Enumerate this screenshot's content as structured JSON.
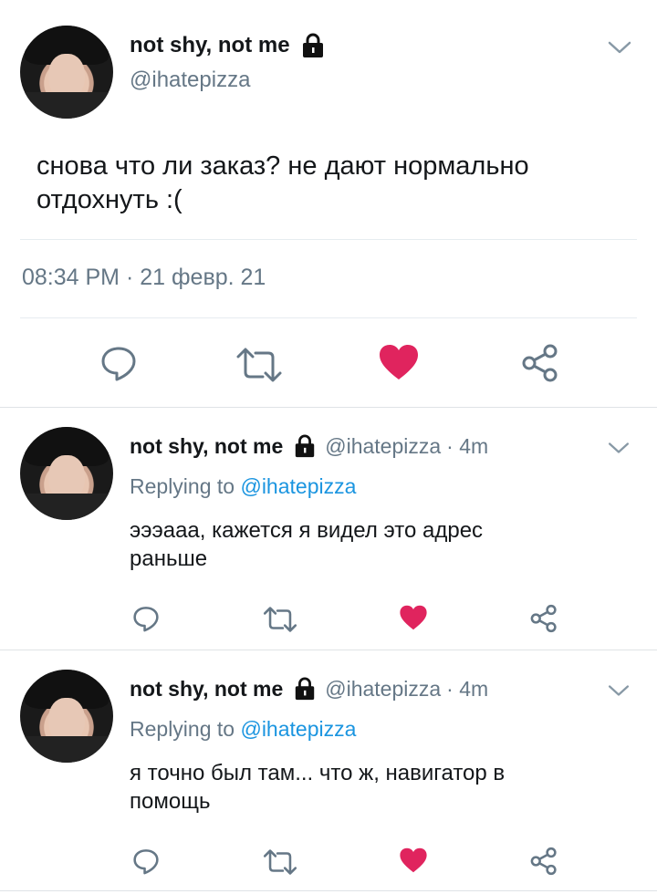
{
  "main_tweet": {
    "name": "not shy, not me",
    "handle": "@ihatepizza",
    "text": "снова что ли заказ? не дают нормально отдохнуть :(",
    "timestamp": "08:34 PM · 21 февр. 21",
    "liked": true
  },
  "replies": [
    {
      "name": "not shy, not me",
      "handle": "@ihatepizza",
      "time": "· 4m",
      "replying_label": "Replying to",
      "replying_to": "@ihatepizza",
      "text": "эээааа, кажется я видел это адрес раньше",
      "liked": true
    },
    {
      "name": "not shy, not me",
      "handle": "@ihatepizza",
      "time": "· 4m",
      "replying_label": "Replying to",
      "replying_to": "@ihatepizza",
      "text": "я точно был там... что ж, навигатор в помощь",
      "liked": true
    }
  ],
  "colors": {
    "like": "#e0245e",
    "link": "#1b95e0",
    "muted": "#657786",
    "icon": "#657786"
  },
  "icons": [
    "chevron-down-icon",
    "lock-icon",
    "reply-icon",
    "retweet-icon",
    "heart-icon",
    "share-icon"
  ]
}
